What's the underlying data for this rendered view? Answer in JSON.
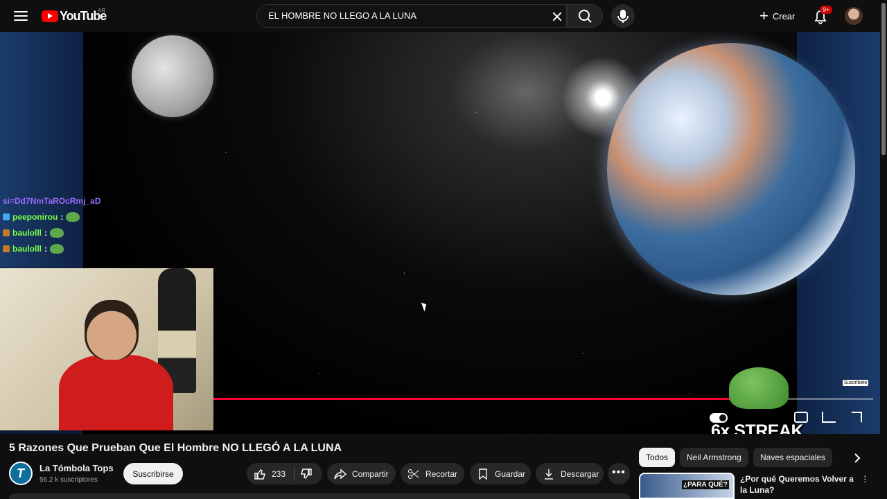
{
  "header": {
    "logo_text": "YouTube",
    "region": "AR",
    "search_value": "EL HOMBRE NO LLEGO A LA LUNA",
    "create_label": "Crear",
    "notification_count": "9+"
  },
  "player": {
    "progress_fraction": 0.785,
    "chat": [
      {
        "user": "si=Dd7NmTaROcRmj_aD",
        "type": "system"
      },
      {
        "user": "peeponirou",
        "suffix": ":"
      },
      {
        "user": "baulolll",
        "suffix": ":"
      },
      {
        "user": "baulolll",
        "suffix": ":"
      }
    ],
    "streak_text": "6x STREAK",
    "overlay_badge": "Suscríbete"
  },
  "video": {
    "title": "5 Razones Que Prueban Que El Hombre NO LLEGÓ A LA LUNA",
    "channel_name": "La Tómbola Tops",
    "channel_subs": "56.2 k suscriptores",
    "subscribe_label": "Suscribirse",
    "like_count": "233",
    "share_label": "Compartir",
    "clip_label": "Recortar",
    "save_label": "Guardar",
    "download_label": "Descargar"
  },
  "sidebar": {
    "chips": [
      "Todos",
      "Neil Armstrong",
      "Naves espaciales"
    ],
    "recommendation_title": "¿Por qué Queremos Volver a la Luna?",
    "recommendation_thumb_text": "¿PARA QUÉ?"
  }
}
